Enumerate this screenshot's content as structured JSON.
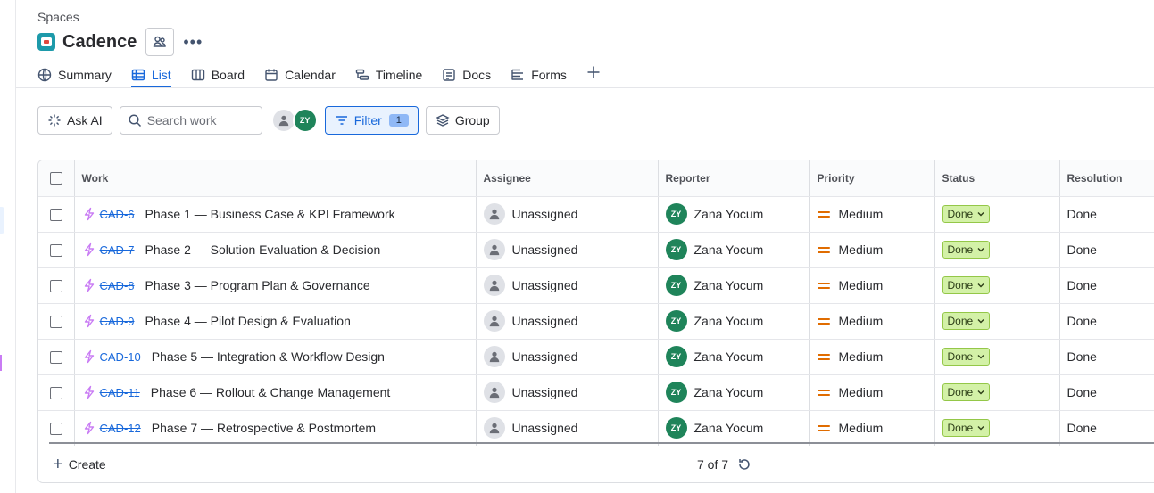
{
  "breadcrumb": "Spaces",
  "space": {
    "title": "Cadence",
    "more_label": "•••"
  },
  "tabs": [
    {
      "label": "Summary",
      "icon": "globe-icon"
    },
    {
      "label": "List",
      "icon": "list-icon",
      "active": true
    },
    {
      "label": "Board",
      "icon": "board-icon"
    },
    {
      "label": "Calendar",
      "icon": "calendar-icon"
    },
    {
      "label": "Timeline",
      "icon": "timeline-icon"
    },
    {
      "label": "Docs",
      "icon": "docs-icon"
    },
    {
      "label": "Forms",
      "icon": "forms-icon"
    }
  ],
  "toolbar": {
    "ask_ai_label": "Ask AI",
    "search_placeholder": "Search work",
    "avatar_initials": "ZY",
    "filter_label": "Filter",
    "filter_count": "1",
    "group_label": "Group"
  },
  "table": {
    "columns": [
      "Work",
      "Assignee",
      "Reporter",
      "Priority",
      "Status",
      "Resolution"
    ],
    "rows": [
      {
        "key": "CAD-6",
        "summary": "Phase 1 — Business Case & KPI Framework",
        "assignee": "Unassigned",
        "reporter_initials": "ZY",
        "reporter": "Zana Yocum",
        "priority": "Medium",
        "status": "Done",
        "resolution": "Done"
      },
      {
        "key": "CAD-7",
        "summary": "Phase 2 — Solution Evaluation & Decision",
        "assignee": "Unassigned",
        "reporter_initials": "ZY",
        "reporter": "Zana Yocum",
        "priority": "Medium",
        "status": "Done",
        "resolution": "Done"
      },
      {
        "key": "CAD-8",
        "summary": "Phase 3 — Program Plan & Governance",
        "assignee": "Unassigned",
        "reporter_initials": "ZY",
        "reporter": "Zana Yocum",
        "priority": "Medium",
        "status": "Done",
        "resolution": "Done"
      },
      {
        "key": "CAD-9",
        "summary": "Phase 4 — Pilot Design & Evaluation",
        "assignee": "Unassigned",
        "reporter_initials": "ZY",
        "reporter": "Zana Yocum",
        "priority": "Medium",
        "status": "Done",
        "resolution": "Done"
      },
      {
        "key": "CAD-10",
        "summary": "Phase 5 — Integration & Workflow Design",
        "assignee": "Unassigned",
        "reporter_initials": "ZY",
        "reporter": "Zana Yocum",
        "priority": "Medium",
        "status": "Done",
        "resolution": "Done"
      },
      {
        "key": "CAD-11",
        "summary": "Phase 6 — Rollout & Change Management",
        "assignee": "Unassigned",
        "reporter_initials": "ZY",
        "reporter": "Zana Yocum",
        "priority": "Medium",
        "status": "Done",
        "resolution": "Done"
      },
      {
        "key": "CAD-12",
        "summary": "Phase 7 — Retrospective & Postmortem",
        "assignee": "Unassigned",
        "reporter_initials": "ZY",
        "reporter": "Zana Yocum",
        "priority": "Medium",
        "status": "Done",
        "resolution": "Done"
      }
    ]
  },
  "footer": {
    "create_label": "Create",
    "count_label": "7 of 7"
  },
  "colors": {
    "accent": "#1868db",
    "status_done_bg": "#d3f1a7",
    "priority_medium": "#e06c00",
    "avatar_green": "#1f845a",
    "work_icon": "#c97cf4"
  }
}
